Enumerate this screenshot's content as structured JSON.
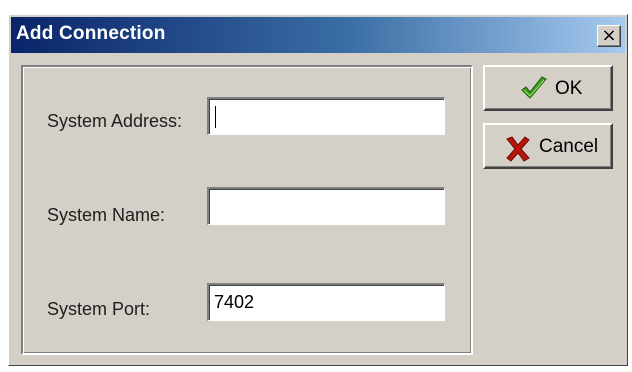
{
  "dialog": {
    "title": "Add Connection",
    "close_glyph": "×"
  },
  "form": {
    "address": {
      "label": "System Address:",
      "value": ""
    },
    "name": {
      "label": "System Name:",
      "value": ""
    },
    "port": {
      "label": "System Port:",
      "value": "7402"
    }
  },
  "buttons": {
    "ok_label": "OK",
    "ok_icon": "checkmark-icon",
    "cancel_label": "Cancel",
    "cancel_icon": "x-mark-icon"
  },
  "colors": {
    "title_gradient_start": "#0a246a",
    "title_gradient_end": "#a6caf0",
    "ok_icon": "#3a9a1a",
    "cancel_icon": "#b8140a",
    "face": "#d4d0c8"
  }
}
